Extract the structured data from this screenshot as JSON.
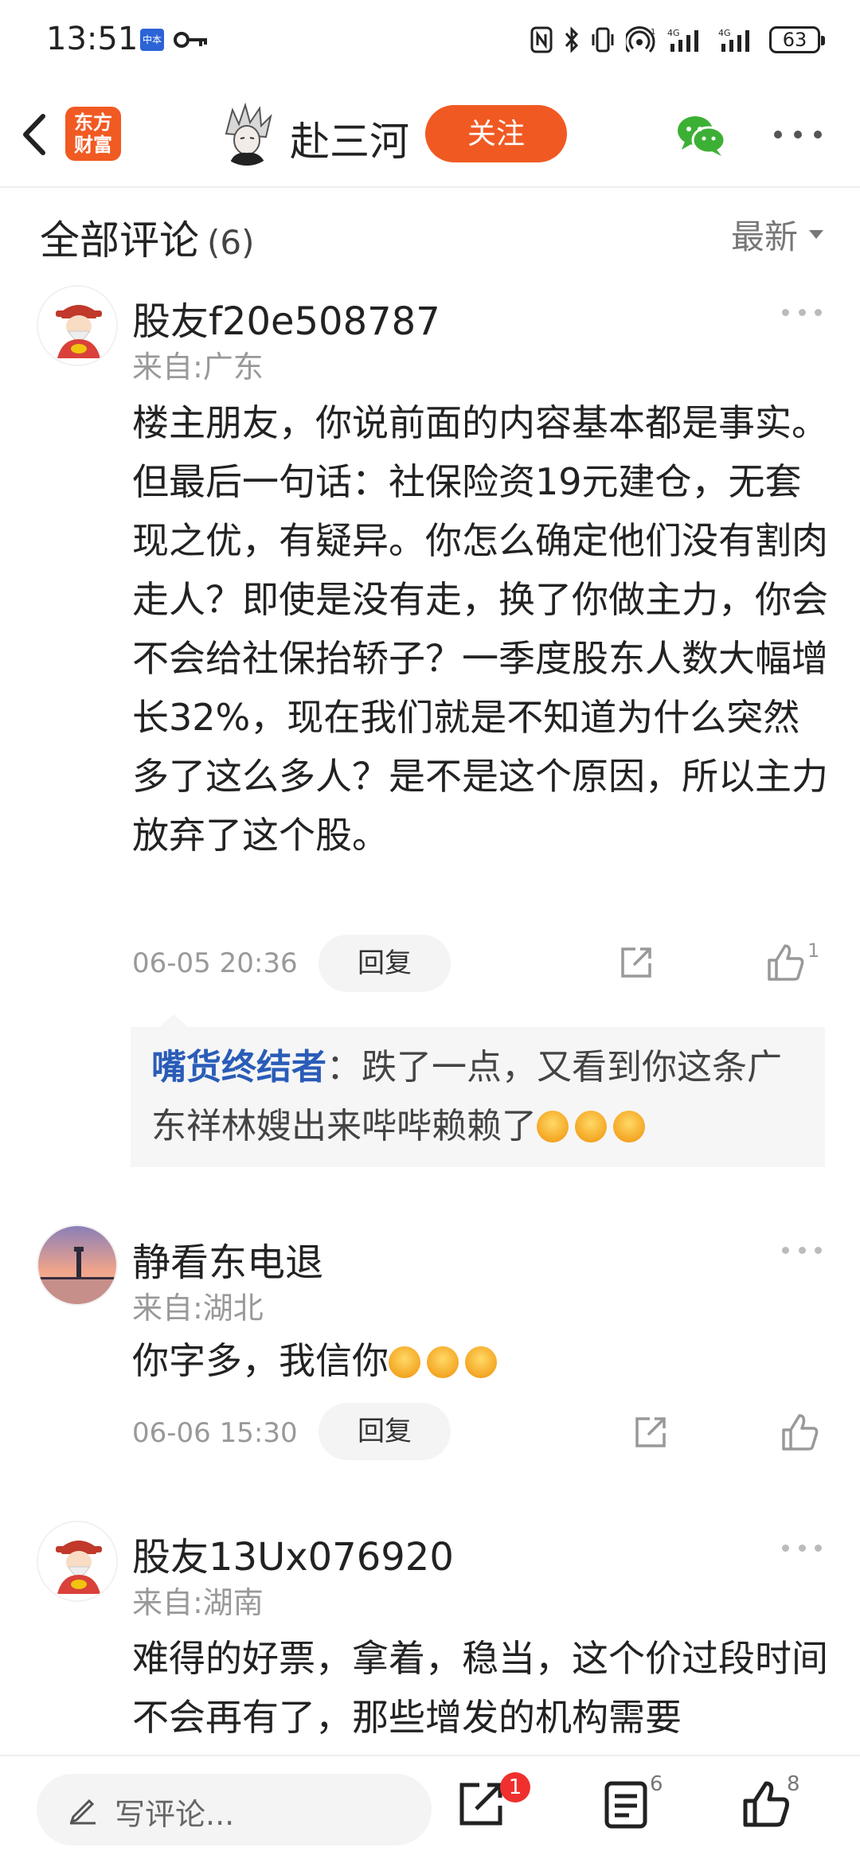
{
  "status_bar": {
    "time": "13:51",
    "carrier_badge": "中本",
    "battery": "63",
    "icons": [
      "nfc-icon",
      "bluetooth-icon",
      "vibrate-icon",
      "hotspot-icon",
      "signal-4g-icon",
      "signal-4g-icon"
    ]
  },
  "header": {
    "logo_text": "东方财富",
    "author_name": "赴三河",
    "follow_label": "关注"
  },
  "section": {
    "title": "全部评论",
    "count": "(6)",
    "sort_label": "最新"
  },
  "comments": [
    {
      "username": "股友f20e508787",
      "location": "来自:广东",
      "text": "楼主朋友，你说前面的内容基本都是事实。但最后一句话：社保险资19元建仓，无套现之优，有疑异。你怎么确定他们没有割肉走人？即使是没有走，换了你做主力，你会不会给社保抬轿子？一季度股东人数大幅增长32%，现在我们就是不知道为什么突然多了这么多人？是不是这个原因，所以主力放弃了这个股。",
      "time": "06-05 20:36",
      "reply_label": "回复",
      "like_count": "1",
      "reply": {
        "user": "嘴货终结者",
        "text": "：跌了一点，又看到你这条广东祥林嫂出来哔哔赖赖了"
      }
    },
    {
      "username": "静看东电退",
      "location": "来自:湖北",
      "text": "你字多，我信你",
      "time": "06-06 15:30",
      "reply_label": "回复",
      "like_count": ""
    },
    {
      "username": "股友13Ux076920",
      "location": "来自:湖南",
      "text": "难得的好票，拿着，稳当，这个价过段时间不会再有了，那些增发的机构需要"
    }
  ],
  "bottom_bar": {
    "input_placeholder": "写评论...",
    "share_badge": "1",
    "comment_count": "6",
    "like_count": "8"
  }
}
